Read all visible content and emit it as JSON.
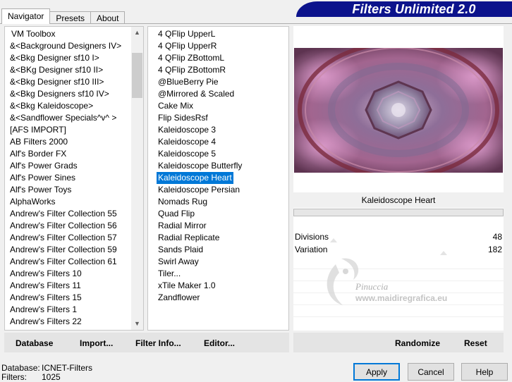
{
  "tabs": [
    {
      "label": "Navigator",
      "active": true
    },
    {
      "label": "Presets",
      "active": false
    },
    {
      "label": "About",
      "active": false
    }
  ],
  "banner": {
    "title": "Filters Unlimited 2.0",
    "color": "#0c138c"
  },
  "categories": {
    "items": [
      "VM Toolbox",
      "&<Background Designers IV>",
      "&<Bkg Designer sf10 I>",
      "&<BKg Designer sf10 II>",
      "&<Bkg Designer sf10 III>",
      "&<Bkg Designers sf10 IV>",
      "&<Bkg Kaleidoscope>",
      "&<Sandflower Specials^v^ >",
      "[AFS IMPORT]",
      "AB Filters 2000",
      "Alf's Border FX",
      "Alf's Power Grads",
      "Alf's Power Sines",
      "Alf's Power Toys",
      "AlphaWorks",
      "Andrew's Filter Collection 55",
      "Andrew's Filter Collection 56",
      "Andrew's Filter Collection 57",
      "Andrew's Filter Collection 59",
      "Andrew's Filter Collection 61",
      "Andrew's Filters 10",
      "Andrew's Filters 11",
      "Andrew's Filters 15",
      "Andrew's Filters 1",
      "Andrew's Filters 22"
    ],
    "scroll_up_icon": "triangle-up",
    "scroll_down_icon": "triangle-down"
  },
  "filters": {
    "items": [
      "4 QFlip UpperL",
      "4 QFlip UpperR",
      "4 QFlip ZBottomL",
      "4 QFlip ZBottomR",
      "@BlueBerry Pie",
      "@Mirrored & Scaled",
      "Cake Mix",
      "Flip SidesRsf",
      "Kaleidoscope 3",
      "Kaleidoscope 4",
      "Kaleidoscope 5",
      "Kaleidoscope Butterfly",
      "Kaleidoscope Heart",
      "Kaleidoscope Persian",
      "Nomads Rug",
      "Quad Flip",
      "Radial Mirror",
      "Radial Replicate",
      "Sands Plaid",
      "Swirl Away",
      "Tiler...",
      "xTile Maker 1.0",
      "Zandflower"
    ],
    "selected_index": 12,
    "selection_color": "#0078d7"
  },
  "preview": {
    "filter_name": "Kaleidoscope Heart",
    "params": [
      {
        "label": "Divisions",
        "value": "48"
      },
      {
        "label": "Variation",
        "value": "182"
      }
    ],
    "watermark": {
      "line1": "Pinuccia",
      "line2": "www.maidiregrafica.eu"
    }
  },
  "toolbar_left": {
    "database": "Database",
    "import": "Import...",
    "filter_info": "Filter Info...",
    "editor": "Editor..."
  },
  "toolbar_right": {
    "randomize": "Randomize",
    "reset": "Reset"
  },
  "status": {
    "database_label": "Database:",
    "database_value": "ICNET-Filters",
    "filters_label": "Filters:",
    "filters_value": "1025"
  },
  "dialog": {
    "apply": "Apply",
    "cancel": "Cancel",
    "help": "Help"
  }
}
